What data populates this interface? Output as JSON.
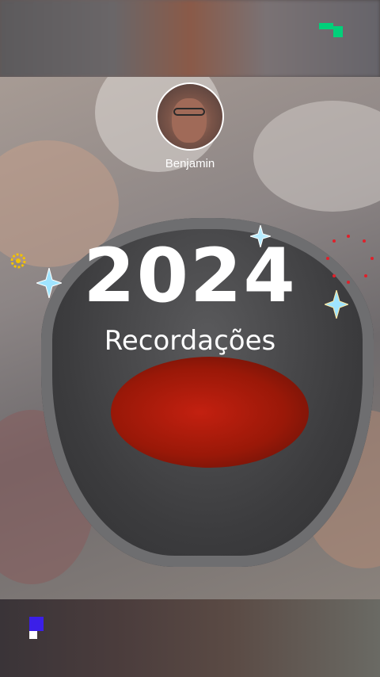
{
  "story": {
    "username": "Benjamin",
    "year": "2024",
    "subtitle": "Recordações"
  },
  "icons": {
    "brand_top": "green-pixel-logo-icon",
    "brand_bottom": "blue-pixel-logo-icon",
    "decor": [
      "sparkle-icon",
      "flower-icon",
      "dots-icon"
    ]
  },
  "colors": {
    "text": "#ffffff",
    "brand_green": "#00d07a",
    "brand_blue": "#3b1fe8",
    "sparkle": "#9fe4ff",
    "flower": "#f2c200",
    "dots": "#e0202a"
  }
}
